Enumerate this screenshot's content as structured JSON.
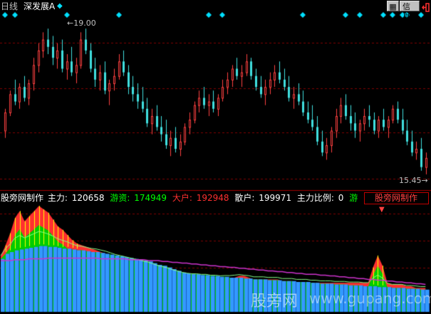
{
  "header": {
    "period_label": "日线",
    "stock_name": "深发展A",
    "stock_marker": "◆",
    "info_button": "信息",
    "colors": {
      "period": "#c0c0c0",
      "name": "#ffffff",
      "diamond": "#00e0ff"
    }
  },
  "price_chart": {
    "high_label": "19.00",
    "low_label": "15.45",
    "grid_color": "#800000",
    "up_color": "#ff4040",
    "down_color": "#40e0e0",
    "candles": [
      [
        16.2,
        16.8,
        16.0,
        16.7
      ],
      [
        16.7,
        17.3,
        16.6,
        17.2
      ],
      [
        17.2,
        17.6,
        16.9,
        17.0
      ],
      [
        17.0,
        17.5,
        16.8,
        17.4
      ],
      [
        17.4,
        17.7,
        17.0,
        17.1
      ],
      [
        17.1,
        17.6,
        16.9,
        17.5
      ],
      [
        17.5,
        18.2,
        17.3,
        18.0
      ],
      [
        18.0,
        18.6,
        17.8,
        18.4
      ],
      [
        18.4,
        18.9,
        18.2,
        18.7
      ],
      [
        18.7,
        19.0,
        18.3,
        18.5
      ],
      [
        18.5,
        18.8,
        18.0,
        18.2
      ],
      [
        18.2,
        18.6,
        17.9,
        18.4
      ],
      [
        18.4,
        18.7,
        17.8,
        17.9
      ],
      [
        17.9,
        18.3,
        17.6,
        18.1
      ],
      [
        18.1,
        18.5,
        17.7,
        17.8
      ],
      [
        17.8,
        18.2,
        17.5,
        18.0
      ],
      [
        18.0,
        18.9,
        17.9,
        18.7
      ],
      [
        18.7,
        19.0,
        18.3,
        18.4
      ],
      [
        18.4,
        18.6,
        17.8,
        17.9
      ],
      [
        17.9,
        18.2,
        17.4,
        17.6
      ],
      [
        17.6,
        18.0,
        17.3,
        17.8
      ],
      [
        17.8,
        18.1,
        17.2,
        17.3
      ],
      [
        17.3,
        17.6,
        16.9,
        17.5
      ],
      [
        17.5,
        17.9,
        17.3,
        17.7
      ],
      [
        17.7,
        18.3,
        17.6,
        18.1
      ],
      [
        18.1,
        18.4,
        17.7,
        17.8
      ],
      [
        17.8,
        18.0,
        17.2,
        17.4
      ],
      [
        17.4,
        17.7,
        17.0,
        17.2
      ],
      [
        17.2,
        17.5,
        16.8,
        17.0
      ],
      [
        17.0,
        17.4,
        16.7,
        16.8
      ],
      [
        16.8,
        17.1,
        16.3,
        16.4
      ],
      [
        16.4,
        16.8,
        16.1,
        16.6
      ],
      [
        16.6,
        16.9,
        16.2,
        16.3
      ],
      [
        16.3,
        16.6,
        15.9,
        16.1
      ],
      [
        16.1,
        16.5,
        15.7,
        15.8
      ],
      [
        15.8,
        16.2,
        15.5,
        16.0
      ],
      [
        16.0,
        16.3,
        15.6,
        15.7
      ],
      [
        15.7,
        16.1,
        15.5,
        15.9
      ],
      [
        15.9,
        16.4,
        15.8,
        16.3
      ],
      [
        16.3,
        16.7,
        16.1,
        16.5
      ],
      [
        16.5,
        17.0,
        16.4,
        16.9
      ],
      [
        16.9,
        17.3,
        16.7,
        17.1
      ],
      [
        17.1,
        17.4,
        16.8,
        16.9
      ],
      [
        16.9,
        17.2,
        16.6,
        17.0
      ],
      [
        17.0,
        17.3,
        16.7,
        16.8
      ],
      [
        16.8,
        17.2,
        16.6,
        17.1
      ],
      [
        17.1,
        17.6,
        17.0,
        17.4
      ],
      [
        17.4,
        17.8,
        17.2,
        17.6
      ],
      [
        17.6,
        18.0,
        17.4,
        17.9
      ],
      [
        17.9,
        18.2,
        17.6,
        17.7
      ],
      [
        17.7,
        18.0,
        17.4,
        17.8
      ],
      [
        17.8,
        18.3,
        17.7,
        18.1
      ],
      [
        18.1,
        18.2,
        17.6,
        17.7
      ],
      [
        17.7,
        17.9,
        17.3,
        17.4
      ],
      [
        17.4,
        17.7,
        17.1,
        17.2
      ],
      [
        17.2,
        17.6,
        16.9,
        17.4
      ],
      [
        17.4,
        17.8,
        17.2,
        17.6
      ],
      [
        17.6,
        18.0,
        17.4,
        17.8
      ],
      [
        17.8,
        18.1,
        17.5,
        17.6
      ],
      [
        17.6,
        17.9,
        17.3,
        17.4
      ],
      [
        17.4,
        17.7,
        17.0,
        17.1
      ],
      [
        17.1,
        17.4,
        16.8,
        17.2
      ],
      [
        17.2,
        17.5,
        16.9,
        17.0
      ],
      [
        17.0,
        17.3,
        16.6,
        16.7
      ],
      [
        16.7,
        17.0,
        16.4,
        16.5
      ],
      [
        16.5,
        16.9,
        16.2,
        16.3
      ],
      [
        16.3,
        16.6,
        15.8,
        15.9
      ],
      [
        15.9,
        16.2,
        15.5,
        15.6
      ],
      [
        15.6,
        16.0,
        15.4,
        15.8
      ],
      [
        15.8,
        16.3,
        15.6,
        16.2
      ],
      [
        16.2,
        16.8,
        16.0,
        16.6
      ],
      [
        16.6,
        17.1,
        16.4,
        16.9
      ],
      [
        16.9,
        17.2,
        16.5,
        16.6
      ],
      [
        16.6,
        16.9,
        16.2,
        16.4
      ],
      [
        16.4,
        16.7,
        16.0,
        16.2
      ],
      [
        16.2,
        16.5,
        15.9,
        16.4
      ],
      [
        16.4,
        16.8,
        16.2,
        16.6
      ],
      [
        16.6,
        16.9,
        16.3,
        16.5
      ],
      [
        16.5,
        16.7,
        16.1,
        16.2
      ],
      [
        16.2,
        16.6,
        16.0,
        16.5
      ],
      [
        16.5,
        16.8,
        16.2,
        16.3
      ],
      [
        16.3,
        16.6,
        16.0,
        16.5
      ],
      [
        16.5,
        16.9,
        16.4,
        16.8
      ],
      [
        16.8,
        17.0,
        16.4,
        16.5
      ],
      [
        16.5,
        16.8,
        16.1,
        16.2
      ],
      [
        16.2,
        16.5,
        15.8,
        15.9
      ],
      [
        15.9,
        16.2,
        15.5,
        15.6
      ],
      [
        15.6,
        15.9,
        15.4,
        15.7
      ],
      [
        15.7,
        16.0,
        15.1,
        15.2
      ],
      [
        15.2,
        15.6,
        15.0,
        15.45
      ]
    ],
    "diamond_slots": [
      0,
      2,
      13,
      24,
      43,
      46,
      63,
      72,
      75,
      80,
      82,
      84,
      85,
      88
    ]
  },
  "indicator": {
    "name_label": "股旁网制作",
    "items": [
      {
        "label": "主力:",
        "value": "120658",
        "color": "#ffffff"
      },
      {
        "label": "游资:",
        "value": "174949",
        "color": "#00ff00"
      },
      {
        "label": "大户:",
        "value": "192948",
        "color": "#ff3030"
      },
      {
        "label": "散户:",
        "value": "199971",
        "color": "#ffffff"
      },
      {
        "label": "主力比例:",
        "value": "0",
        "color": "#ffffff"
      },
      {
        "label": "游",
        "value": "",
        "color": "#00ff00"
      }
    ],
    "selector_label": "股旁网制作",
    "selector_arrow": "▼",
    "retail_color": "#3399ff",
    "hot_color": "#ff3030",
    "green_color": "#00cc00",
    "yellow_color": "#ffff00",
    "line_color": "#cc33cc",
    "retail_values": [
      62,
      68,
      70,
      72,
      73,
      74,
      75,
      76,
      77,
      77,
      76,
      76,
      75,
      74,
      74,
      73,
      72,
      72,
      71,
      70,
      70,
      69,
      68,
      67,
      66,
      65,
      64,
      63,
      62,
      61,
      60,
      59,
      57,
      55,
      54,
      52,
      50,
      48,
      46,
      45,
      44,
      44,
      43,
      43,
      42,
      42,
      41,
      41,
      40,
      40,
      40,
      39,
      39,
      38,
      38,
      38,
      37,
      37,
      37,
      36,
      36,
      36,
      35,
      35,
      35,
      34,
      34,
      33,
      33,
      33,
      32,
      32,
      32,
      31,
      31,
      31,
      30,
      30,
      30,
      29,
      29,
      29,
      28,
      28,
      28,
      27,
      27,
      27,
      26,
      26
    ],
    "hot_values": [
      65,
      78,
      92,
      110,
      118,
      106,
      112,
      118,
      124,
      120,
      116,
      108,
      100,
      96,
      90,
      84,
      80,
      78,
      76,
      74,
      72,
      70,
      68,
      64,
      60,
      58,
      56,
      54,
      52,
      50,
      48,
      46,
      44,
      42,
      40,
      40,
      38,
      38,
      37,
      36,
      36,
      36,
      36,
      36,
      35,
      35,
      35,
      36,
      38,
      40,
      42,
      42,
      40,
      38,
      38,
      38,
      38,
      38,
      38,
      36,
      36,
      36,
      35,
      35,
      35,
      34,
      34,
      34,
      34,
      34,
      34,
      34,
      34,
      34,
      34,
      34,
      34,
      34,
      52,
      66,
      54,
      34,
      32,
      32,
      32,
      30,
      30,
      28,
      28,
      28
    ],
    "line_values": [
      60,
      60,
      60,
      61,
      61,
      61,
      62,
      62,
      62,
      62,
      63,
      63,
      63,
      63,
      63,
      63,
      63,
      63,
      63,
      63,
      63,
      62,
      62,
      62,
      62,
      62,
      62,
      61,
      61,
      61,
      61,
      60,
      60,
      60,
      59,
      59,
      58,
      58,
      57,
      57,
      56,
      56,
      55,
      55,
      54,
      54,
      53,
      53,
      52,
      52,
      51,
      51,
      50,
      50,
      49,
      49,
      48,
      48,
      47,
      47,
      46,
      46,
      45,
      45,
      44,
      44,
      44,
      43,
      43,
      42,
      42,
      41,
      41,
      40,
      40,
      39,
      39,
      38,
      38,
      37,
      37,
      36,
      36,
      35,
      35,
      34,
      34,
      33,
      33,
      32
    ]
  },
  "watermark": {
    "site_cn": "股旁网",
    "site_url": "www.gupang.com"
  }
}
